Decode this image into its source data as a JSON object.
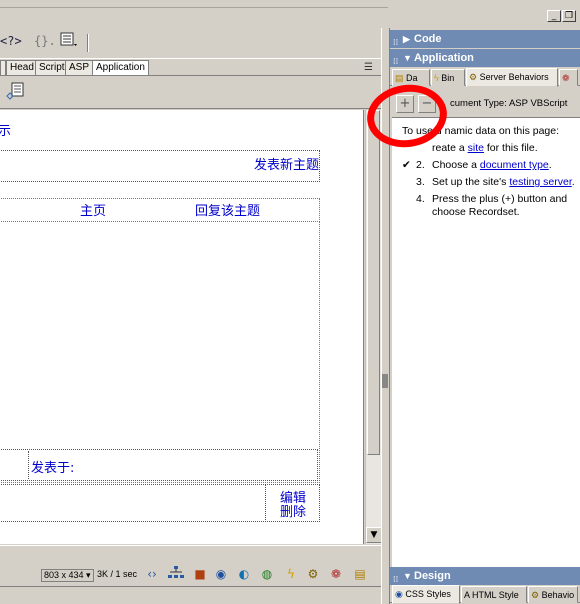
{
  "toolbar": {
    "code_nav_icon": "<?>",
    "braces_icon": "{}.",
    "options_icon": "list-options-icon"
  },
  "insert_tabs": [
    "Head",
    "Script",
    "ASP",
    "Application"
  ],
  "document": {
    "partial_char": "示",
    "new_topic": "发表新主题",
    "home": "主页",
    "reply": "回复该主题",
    "posted_at": "发表于:",
    "edit": "编辑",
    "delete": "删除"
  },
  "status_bar": {
    "window_size": "803 x 434",
    "download": "3K / 1 sec"
  },
  "panels": {
    "code": {
      "title": "Code"
    },
    "application": {
      "title": "Application",
      "tabs": [
        "Da",
        "Bin",
        "Server Behaviors"
      ],
      "document_type": "cument Type: ASP VBScript",
      "intro": "To use d  namic data on this page:",
      "steps": [
        {
          "prefix": "reate a ",
          "link": "site",
          "suffix": " for this file."
        },
        {
          "num": "2.",
          "prefix": "Choose a ",
          "link": "document type",
          "suffix": "."
        },
        {
          "num": "3.",
          "prefix": "Set up the site's ",
          "link": "testing server",
          "suffix": "."
        },
        {
          "num": "4.",
          "prefix": "Press the plus (+) button and",
          "link": "",
          "suffix": ""
        },
        {
          "num": "",
          "prefix": "choose Recordset.",
          "link": "",
          "suffix": ""
        }
      ]
    },
    "design": {
      "title": "Design",
      "tabs": [
        "CSS Styles",
        "HTML Style",
        "Behavio"
      ]
    }
  },
  "colors": {
    "panel_header": "#6f8ab3",
    "link": "#0000cc",
    "highlight_circle": "#ff0000"
  }
}
